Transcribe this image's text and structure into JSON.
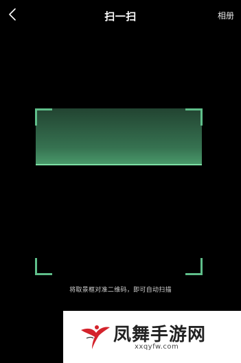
{
  "header": {
    "back_icon": "back-chevron-icon",
    "title": "扫一扫",
    "album_label": "相册"
  },
  "scanner": {
    "hint": "将取景框对准二维码，即可自动扫描",
    "accent_color": "#5fbf8a",
    "scan_line_color": "#7de0a5"
  },
  "watermark": {
    "brand_text": "凤舞手游网",
    "url_text": "xxqyfw.com"
  }
}
